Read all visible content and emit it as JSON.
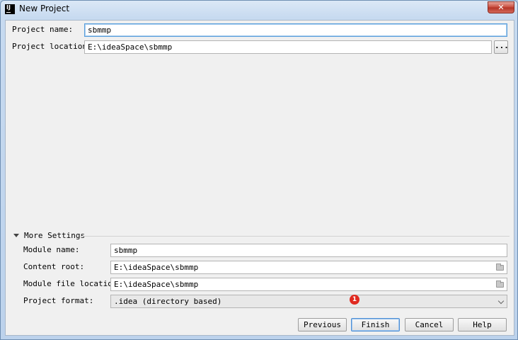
{
  "window": {
    "title": "New Project",
    "app_icon_text": "IJ",
    "close_glyph": "✕"
  },
  "project": {
    "name_label": "Project name:",
    "name_value": "sbmmp",
    "location_label": "Project location:",
    "location_value": "E:\\ideaSpace\\sbmmp",
    "browse_label": "..."
  },
  "more_settings": {
    "header": "More Settings",
    "expanded": true,
    "module_name_label": "Module name:",
    "module_name_value": "sbmmp",
    "content_root_label": "Content root:",
    "content_root_value": "E:\\ideaSpace\\sbmmp",
    "module_file_label": "Module file location:",
    "module_file_value": "E:\\ideaSpace\\sbmmp",
    "format_label": "Project format:",
    "format_value": ".idea (directory based)"
  },
  "buttons": {
    "previous": "Previous",
    "finish": "Finish",
    "cancel": "Cancel",
    "help": "Help"
  },
  "annotation": {
    "badge": "1",
    "badge_color": "#e02a20"
  },
  "icons": [
    "app-icon",
    "close-icon",
    "folder-icon",
    "chevron-down-icon",
    "collapse-triangle-icon"
  ]
}
